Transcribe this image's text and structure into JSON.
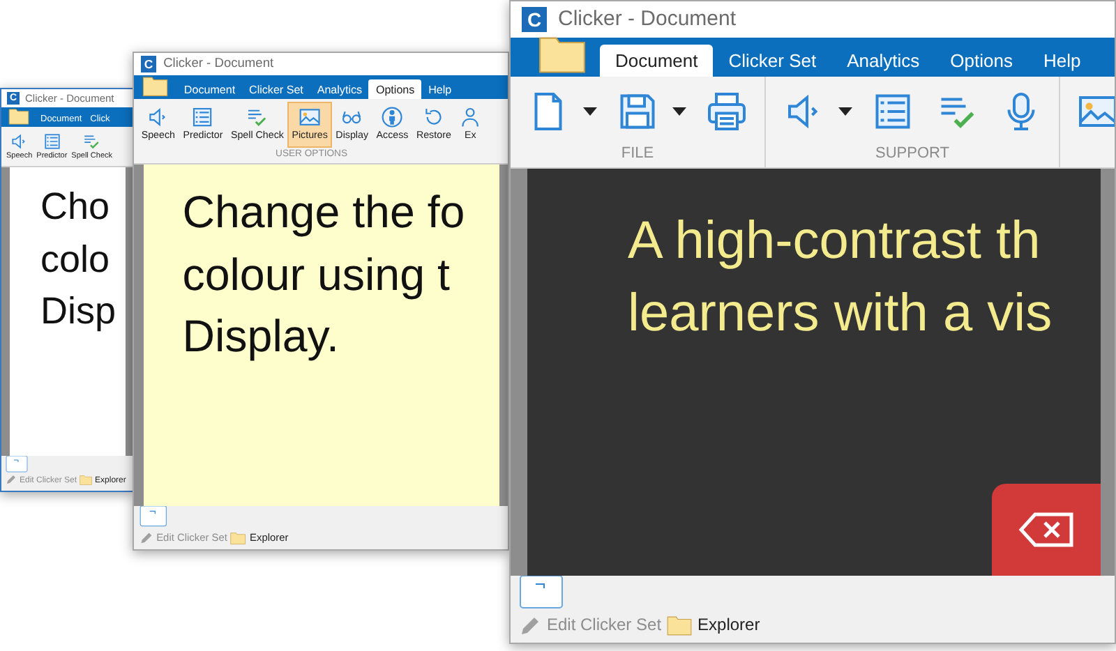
{
  "windows": [
    {
      "title": "Clicker - Document",
      "app_icon": "C",
      "tabs": [
        {
          "label": "Document",
          "selected": false
        },
        {
          "label": "Click",
          "selected": false
        }
      ],
      "ribbon_groups": [
        {
          "buttons": [
            {
              "kind": "speaker",
              "label": "Speech",
              "selected": false
            },
            {
              "kind": "list",
              "label": "Predictor",
              "selected": false
            },
            {
              "kind": "spellcheck",
              "label": "Spell Check",
              "selected": false
            }
          ]
        }
      ],
      "content": {
        "kind": "plain",
        "lines": [
          "Cho",
          "colo",
          "Disp"
        ]
      },
      "footer": {
        "edit_label": "Edit Clicker Set",
        "edit_disabled": true,
        "explorer_label": "Explorer"
      }
    },
    {
      "title": "Clicker - Document",
      "app_icon": "C",
      "tabs": [
        {
          "label": "Document",
          "selected": false
        },
        {
          "label": "Clicker Set",
          "selected": false
        },
        {
          "label": "Analytics",
          "selected": false
        },
        {
          "label": "Options",
          "selected": true
        },
        {
          "label": "Help",
          "selected": false
        }
      ],
      "ribbon_groups": [
        {
          "label": "USER OPTIONS",
          "buttons": [
            {
              "kind": "speaker",
              "label": "Speech",
              "selected": false
            },
            {
              "kind": "list",
              "label": "Predictor",
              "selected": false
            },
            {
              "kind": "spellcheck",
              "label": "Spell Check",
              "selected": false
            },
            {
              "kind": "picture",
              "label": "Pictures",
              "selected": true
            },
            {
              "kind": "glasses",
              "label": "Display",
              "selected": false
            },
            {
              "kind": "access",
              "label": "Access",
              "selected": false
            },
            {
              "kind": "restore",
              "label": "Restore",
              "selected": false
            },
            {
              "kind": "person",
              "label": "Ex",
              "selected": false
            }
          ]
        }
      ],
      "content": {
        "kind": "cream",
        "lines": [
          "Change the fo",
          "colour using t",
          "Display."
        ]
      },
      "footer": {
        "edit_label": "Edit Clicker Set",
        "edit_disabled": true,
        "explorer_label": "Explorer"
      }
    },
    {
      "title": "Clicker - Document",
      "app_icon": "C",
      "tabs": [
        {
          "label": "Document",
          "selected": true
        },
        {
          "label": "Clicker Set",
          "selected": false
        },
        {
          "label": "Analytics",
          "selected": false
        },
        {
          "label": "Options",
          "selected": false
        },
        {
          "label": "Help",
          "selected": false
        }
      ],
      "ribbon_groups": [
        {
          "label": "FILE",
          "buttons": [
            {
              "kind": "new",
              "dropdown": true
            },
            {
              "kind": "save",
              "dropdown": true
            },
            {
              "kind": "print"
            }
          ]
        },
        {
          "label": "SUPPORT",
          "buttons": [
            {
              "kind": "speaker",
              "dropdown": true
            },
            {
              "kind": "list"
            },
            {
              "kind": "spellcheck"
            },
            {
              "kind": "mic"
            }
          ]
        },
        {
          "buttons": [
            {
              "kind": "picture"
            }
          ]
        }
      ],
      "content": {
        "kind": "high-contrast",
        "lines": [
          "A high-contrast th",
          "learners with a vis"
        ],
        "backspace_key": true
      },
      "footer": {
        "edit_label": "Edit Clicker Set",
        "edit_disabled": true,
        "explorer_label": "Explorer"
      }
    }
  ]
}
